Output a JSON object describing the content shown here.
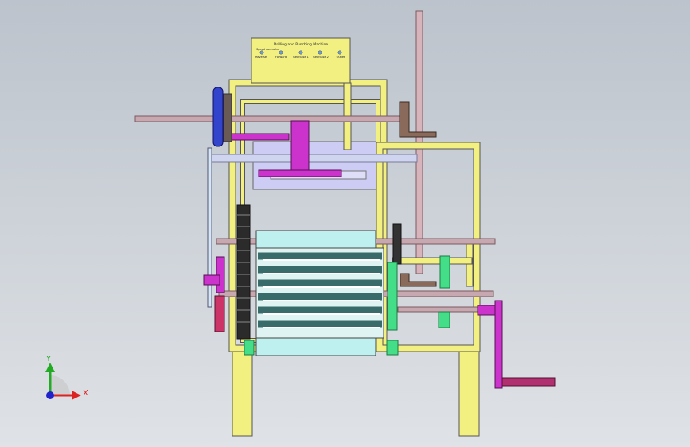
{
  "viewport": {
    "background_top": "#bcc3cc",
    "background_bottom": "#dfe2e6"
  },
  "control_panel": {
    "title": "Drilling and Punching Machine",
    "sub_title": "Speed controller",
    "buttons": [
      {
        "label": "Reverse",
        "color": "#6fa0d8"
      },
      {
        "label": "Forward",
        "color": "#6fa0d8"
      },
      {
        "label": "Gearcase 1",
        "color": "#6fa0d8"
      },
      {
        "label": "Gearcase 2",
        "color": "#6fa0d8"
      },
      {
        "label": "Outlet",
        "color": "#6fa0d8"
      }
    ]
  },
  "triad": {
    "y_label": "Y",
    "x_label": "X",
    "y_color": "#22aa22",
    "x_color": "#dd2222",
    "z_color": "#2222cc"
  },
  "colors": {
    "frame": "#f2f080",
    "roller": "#bff0f0",
    "gear_dark": "#2b2b2b",
    "gear_green": "#44dd88",
    "magenta": "#cc33cc",
    "pulley_blue": "#3344cc",
    "shaft": "#c8a8b0",
    "lavender": "#ccccf5"
  }
}
